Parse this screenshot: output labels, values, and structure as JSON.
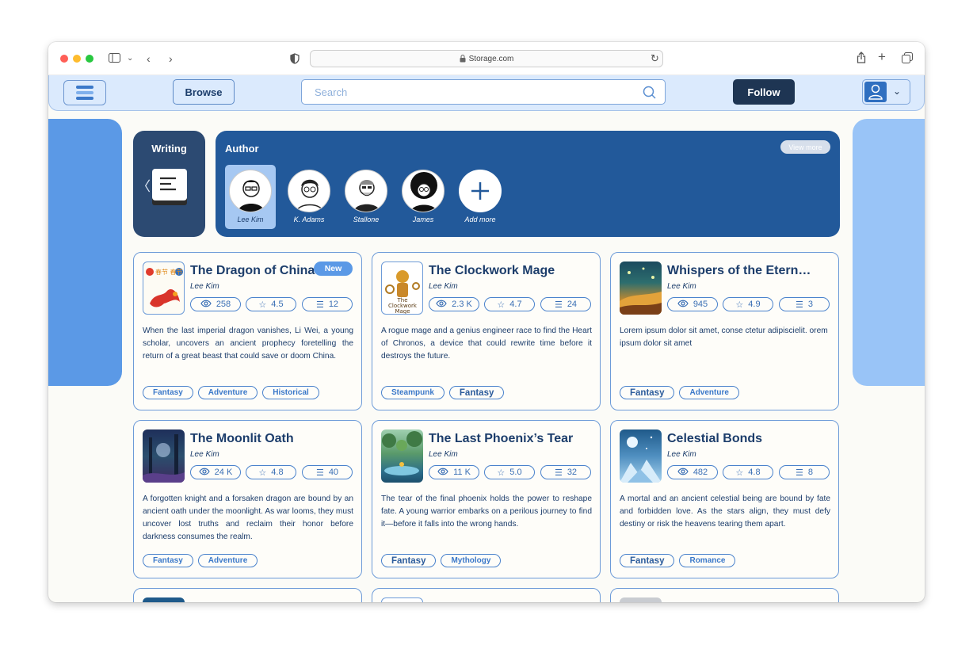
{
  "browser": {
    "url": "Storage.com"
  },
  "nav": {
    "browse_label": "Browse",
    "search_placeholder": "Search",
    "follow_label": "Follow"
  },
  "writing": {
    "title": "Writing"
  },
  "authors": {
    "title": "Author",
    "view_more": "View more",
    "items": [
      {
        "name": "Lee Kim"
      },
      {
        "name": "K. Adams"
      },
      {
        "name": "Stallone"
      },
      {
        "name": "James"
      },
      {
        "name": "Add more"
      }
    ]
  },
  "books": [
    {
      "title": "The Dragon of China",
      "author": "Lee Kim",
      "badge": "New",
      "views": "258",
      "rating": "4.5",
      "chapters": "12",
      "description": "When the last imperial dragon vanishes, Li Wei, a young scholar, uncovers an ancient prophecy foretelling the return of a great beast that could save or doom China.",
      "tags": [
        "Fantasy",
        "Adventure",
        "Historical"
      ],
      "cover_text": "春节 春节"
    },
    {
      "title": "The Clockwork Mage",
      "author": "Lee Kim",
      "views": "2.3 K",
      "rating": "4.7",
      "chapters": "24",
      "description": "A rogue mage and a genius engineer race to find the Heart of Chronos, a device that could rewrite time before it destroys the future.",
      "tags": [
        "Steampunk",
        "Fantasy"
      ],
      "cover_text": "The Clockwork Mage"
    },
    {
      "title": "Whispers of the Etern…",
      "author": "Lee Kim",
      "views": "945",
      "rating": "4.9",
      "chapters": "3",
      "description": "Lorem ipsum dolor sit amet, conse ctetur adipiscielit. orem ipsum dolor sit amet",
      "tags": [
        "Fantasy",
        "Adventure"
      ]
    },
    {
      "title": "The Moonlit Oath",
      "author": "Lee Kim",
      "views": "24 K",
      "rating": "4.8",
      "chapters": "40",
      "description": "A forgotten knight and a forsaken dragon are bound by an ancient oath under the moonlight. As war looms, they must uncover lost truths and reclaim their honor before darkness consumes the realm.",
      "tags": [
        "Fantasy",
        "Adventure"
      ]
    },
    {
      "title": "The Last Phoenix’s Tear",
      "author": "Lee Kim",
      "views": "11 K",
      "rating": "5.0",
      "chapters": "32",
      "description": "The tear of the final phoenix holds the power to reshape fate. A young warrior embarks on a perilous journey to find it—before it falls into the wrong hands.",
      "tags": [
        "Fantasy",
        "Mythology"
      ]
    },
    {
      "title": "Celestial Bonds",
      "author": "Lee Kim",
      "views": "482",
      "rating": "4.8",
      "chapters": "8",
      "description": "A mortal and an ancient celestial being are bound by fate and forbidden love. As the stars align, they must defy destiny or risk the heavens tearing them apart.",
      "tags": [
        "Fantasy",
        "Romance"
      ]
    }
  ]
}
